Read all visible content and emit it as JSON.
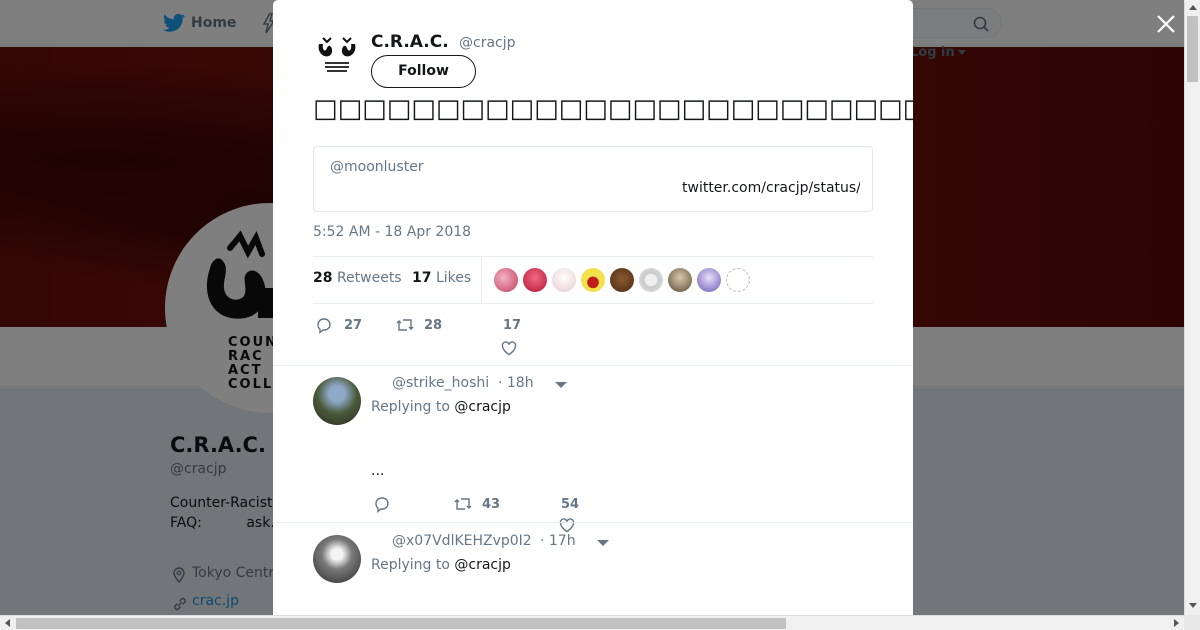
{
  "nav": {
    "home_label": "Home",
    "login_label": "Log in"
  },
  "profile": {
    "name": "C.R.A.C.",
    "handle": "@cracjp",
    "bio": "Counter-Racist\nFAQ:          ask.",
    "location": "Tokyo Centr",
    "link": "crac.jp",
    "avatar_text": "COUN\nRAC\nACT\nCOLLE"
  },
  "tweet": {
    "author_name": "C.R.A.C.",
    "author_handle": "@cracjp",
    "follow_label": "Follow",
    "text": "□□□□□□□□□□□□□□□□□□□□□□□□□□□□□□□□□□□□□□□□□□□□□□□□□□□□□□",
    "quote_user": "@moonluster",
    "quote_link": "twitter.com/cracjp/status/",
    "timestamp": "5:52 AM - 18 Apr 2018",
    "retweets_count": "28",
    "retweets_label": "Retweets",
    "likes_count": "17",
    "likes_label": "Likes",
    "actions": {
      "replies": "27",
      "retweets": "28",
      "likes": "17"
    }
  },
  "replies": [
    {
      "handle": "@strike_hoshi",
      "time": "· 18h",
      "replying_prefix": "Replying to",
      "replying_to": "@cracjp",
      "text": "...",
      "retweets": "43",
      "likes": "54"
    },
    {
      "handle": "@x07VdlKEHZvp0I2",
      "time": "· 17h",
      "replying_prefix": "Replying to",
      "replying_to": "@cracjp"
    }
  ],
  "colors": {
    "accent": "#1da1f2",
    "link": "#1b95e0",
    "muted": "#657786",
    "text": "#14171a",
    "banner": "#6a0e08"
  }
}
